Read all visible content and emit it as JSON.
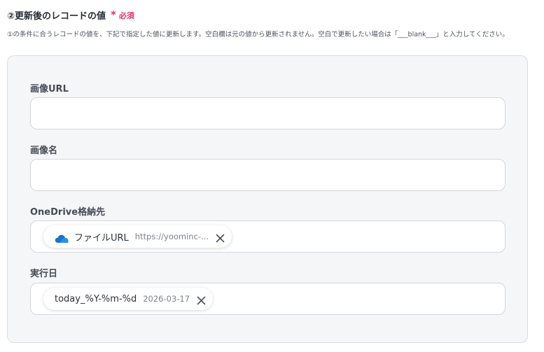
{
  "section": {
    "title": "②更新後のレコードの値",
    "required_mark": "*",
    "required_text": "必須",
    "description": "①の条件に合うレコードの値を、下記で指定した値に更新します。空白欄は元の値から更新されません。空白で更新したい場合は「___blank___」と入力してください。"
  },
  "fields": [
    {
      "label": "画像URL",
      "value": ""
    },
    {
      "label": "画像名",
      "value": ""
    },
    {
      "label": "OneDrive格納先",
      "chip": {
        "icon": "onedrive-cloud-icon",
        "label": "ファイルURL",
        "value": "https://yoominc-..."
      }
    },
    {
      "label": "実行日",
      "chip": {
        "label": "today_%Y-%m-%d",
        "value": "2026-03-17"
      }
    }
  ],
  "colors": {
    "required": "#e8336f",
    "panel_bg": "#f5f6f8",
    "onedrive_blue": "#1a73c9"
  }
}
